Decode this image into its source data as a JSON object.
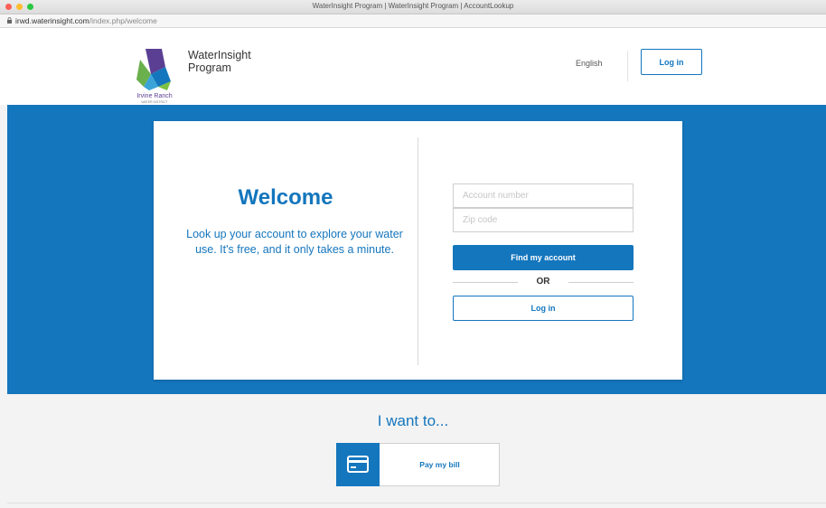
{
  "browser": {
    "window_title": "WaterInsight Program | WaterInsight Program | AccountLookup",
    "url_host": "irwd.waterinsight.com",
    "url_path": "/index.php/welcome"
  },
  "header": {
    "logo_text": "Irvine Ranch",
    "logo_subtext": "WATER DISTRICT",
    "program_name": "WaterInsight Program",
    "language": "English",
    "login_label": "Log in"
  },
  "welcome": {
    "heading": "Welcome",
    "text": "Look up your account to explore your water use. It's free, and it only takes a minute."
  },
  "lookup_form": {
    "account_placeholder": "Account number",
    "zip_placeholder": "Zip code",
    "find_label": "Find my account",
    "or_label": "OR",
    "login_label": "Log in"
  },
  "actions": {
    "heading": "I want to...",
    "pay_label": "Pay my bill",
    "pay_icon": "credit-card-icon"
  },
  "colors": {
    "brand_blue": "#1476bd",
    "logo_green": "#6ab04c",
    "logo_purple": "#5b3f93"
  }
}
